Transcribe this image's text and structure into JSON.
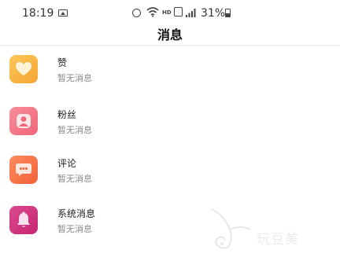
{
  "status_bar": {
    "time": "18:19",
    "network_label": "HD",
    "battery_text": "31%"
  },
  "header": {
    "title": "消息"
  },
  "messages": [
    {
      "title": "赞",
      "subtitle": "暂无消息",
      "icon": "heart-icon",
      "color": "#F8B545"
    },
    {
      "title": "粉丝",
      "subtitle": "暂无消息",
      "icon": "fan-icon",
      "color": "#F47C87"
    },
    {
      "title": "评论",
      "subtitle": "暂无消息",
      "icon": "comment-icon",
      "color": "#F9744C"
    },
    {
      "title": "系统消息",
      "subtitle": "暂无消息",
      "icon": "bell-icon",
      "color": "#D2357F"
    }
  ],
  "watermark": {
    "text": "玩豆美"
  }
}
